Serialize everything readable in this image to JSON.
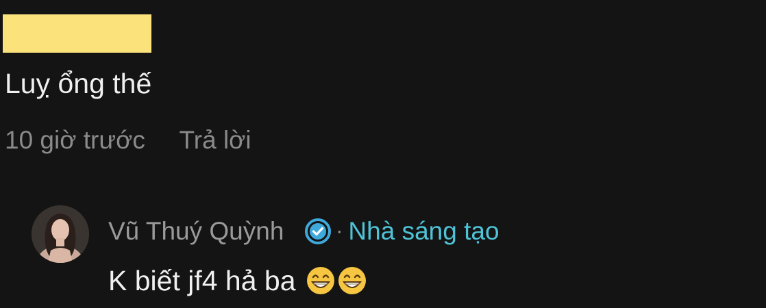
{
  "comment": {
    "text": "Luỵ ổng thế",
    "time": "10 giờ trước",
    "reply_label": "Trả lời"
  },
  "reply": {
    "author": "Vũ Thuý Quỳnh",
    "separator": "·",
    "badge_label": "Nhà sáng tạo",
    "text": "K biết jf4 hả ba",
    "emojis": [
      "grinning-face-icon",
      "grinning-face-icon"
    ]
  },
  "colors": {
    "background": "#141414",
    "redaction": "#fbe27b",
    "muted_text": "#8a8a8a",
    "creator_accent": "#4fc3d7",
    "verified_badge": "#3fa9dc"
  }
}
